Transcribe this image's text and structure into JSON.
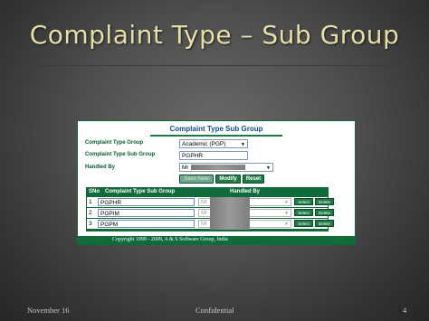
{
  "slide": {
    "title": "Complaint Type – Sub Group",
    "footer_left": "November 16",
    "footer_center": "Confidential",
    "footer_right": "4"
  },
  "app": {
    "title": "Complaint Type Sub Group",
    "form": {
      "complaint_type_group_label": "Complaint Type Group",
      "complaint_type_group_value": "Academic (PGP)",
      "complaint_type_sub_group_label": "Complaint Type Sub Group",
      "complaint_type_sub_group_value": "PGPHR",
      "handled_by_label": "Handled By",
      "handled_by_value": "Mr"
    },
    "buttons": {
      "save_new": "Save New",
      "modify": "Modify",
      "reset": "Reset"
    },
    "grid": {
      "headers": [
        "SNo",
        "Complaint Type Sub Group",
        "Handled By"
      ],
      "rows": [
        {
          "sno": "1",
          "sub_group": "PGPHR",
          "handled_by": "Mr",
          "select": "Select",
          "delete": "Delete"
        },
        {
          "sno": "2",
          "sub_group": "PGPIM",
          "handled_by": "Mr",
          "select": "Select",
          "delete": "Delete"
        },
        {
          "sno": "3",
          "sub_group": "PGPM",
          "handled_by": "Mr",
          "select": "Select",
          "delete": "Delete"
        }
      ]
    },
    "copyright": "Copyright 1999 - 2009, A & S Software Group, India"
  },
  "colors": {
    "accent_green": "#1f7a46",
    "title_blue": "#0d4a8a",
    "slide_title": "#e8dfa8"
  }
}
